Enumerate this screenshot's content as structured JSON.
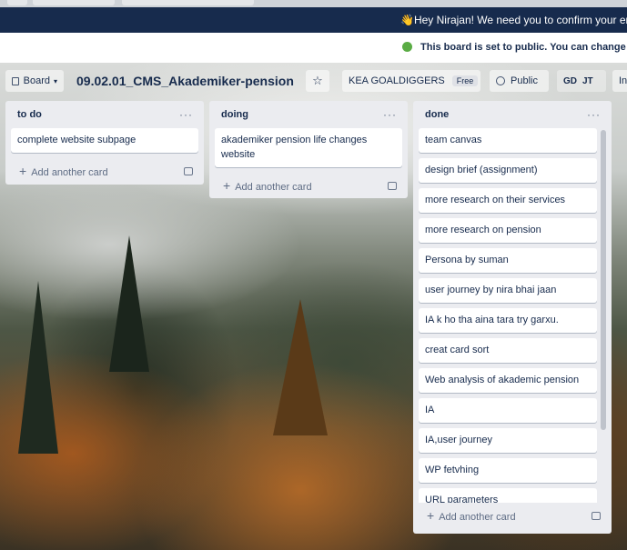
{
  "top_banner": {
    "message": "👋Hey Nirajan! We need you to confirm your email"
  },
  "public_notice": {
    "text": "This board is set to public. You can change it"
  },
  "header": {
    "board_view_label": "Board",
    "board_title": "09.02.01_CMS_Akademiker-pension",
    "team_name": "KEA GOALDIGGERS",
    "team_plan_badge": "Free",
    "visibility": "Public",
    "members": [
      "GD",
      "JT"
    ],
    "invite_label": "In"
  },
  "lists": [
    {
      "title": "to do",
      "cards": [
        "complete website subpage"
      ],
      "add_card_label": "Add another card"
    },
    {
      "title": "doing",
      "cards": [
        "akademiker pension life changes website"
      ],
      "add_card_label": "Add another card"
    },
    {
      "title": "done",
      "cards": [
        "team canvas",
        "design brief (assignment)",
        "more research on their services",
        "more research on pension",
        "Persona by suman",
        "user journey by nira bhai jaan",
        "IA k ho tha aina tara try garxu.",
        "creat card sort",
        "Web analysis of akademic pension",
        "IA",
        "IA,user journey",
        "WP fetvhing",
        "URL parameters"
      ],
      "add_card_label": "Add another card"
    }
  ],
  "icons": [
    "board-icon",
    "chevron-down-icon",
    "star-icon",
    "globe-icon",
    "more-icon",
    "plus-icon",
    "template-icon"
  ],
  "colors": {
    "banner_bg": "#172b4d",
    "list_bg": "#ebecf0",
    "public_green": "#5aac44"
  }
}
